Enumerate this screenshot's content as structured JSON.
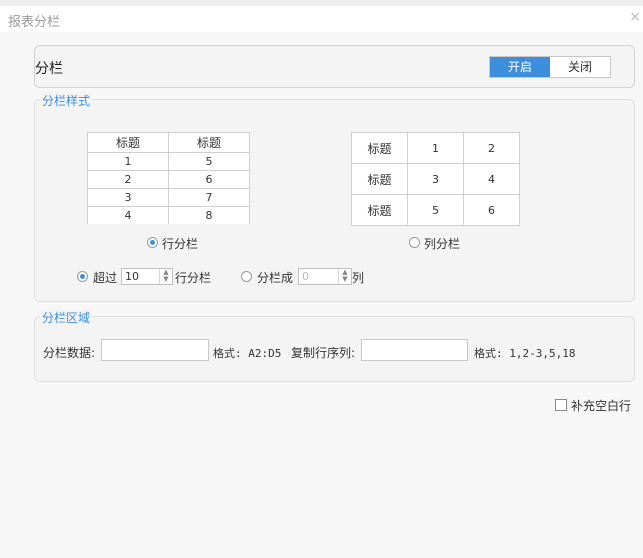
{
  "dialog": {
    "title": "报表分栏"
  },
  "header": {
    "label": "分栏",
    "toggle": {
      "on": "开启",
      "off": "关闭",
      "selected": "开启"
    }
  },
  "style_section": {
    "legend": "分栏样式",
    "row_preview": {
      "rows": [
        [
          "标题",
          "标题"
        ],
        [
          "1",
          "5"
        ],
        [
          "2",
          "6"
        ],
        [
          "3",
          "7"
        ],
        [
          "4",
          "8"
        ]
      ]
    },
    "col_preview": {
      "rows": [
        [
          "标题",
          "1",
          "2"
        ],
        [
          "标题",
          "3",
          "4"
        ],
        [
          "标题",
          "5",
          "6"
        ]
      ]
    },
    "row_option_label": "行分栏",
    "col_option_label": "列分栏",
    "selected_option": "行分栏",
    "exceed_label": "超过",
    "exceed_value": "10",
    "exceed_suffix": "行分栏",
    "split_label": "分栏成",
    "split_value": "0",
    "split_suffix": "列"
  },
  "area_section": {
    "legend": "分栏区域",
    "data_label": "分栏数据:",
    "data_value": "",
    "data_format": "格式: A2:D5",
    "repeat_label": "复制行序列:",
    "repeat_value": "",
    "repeat_format": "格式: 1,2-3,5,18"
  },
  "fill_blank": {
    "label": "补充空白行",
    "checked": false
  }
}
